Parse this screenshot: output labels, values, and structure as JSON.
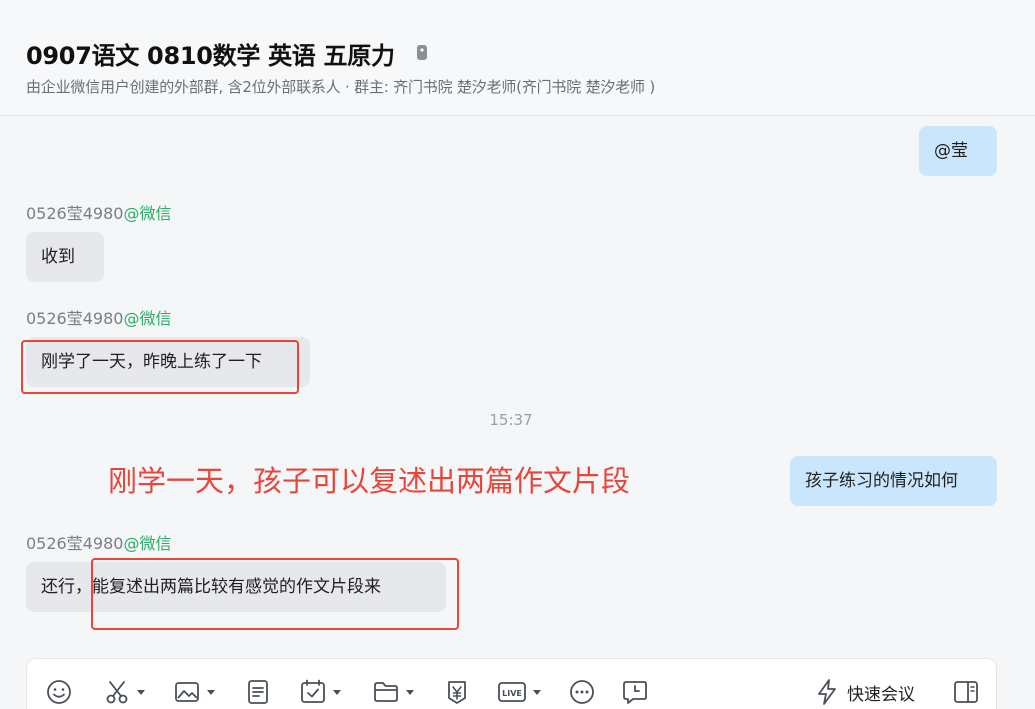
{
  "header": {
    "title": "0907语文  0810数学 英语 五原力",
    "subtitle": "由企业微信用户创建的外部群, 含2位外部联系人 · 群主: 齐门书院 楚汐老师(齐门书院 楚汐老师 )"
  },
  "messages": [
    {
      "side": "me",
      "text": "@莹"
    },
    {
      "side": "them",
      "sender": "0526莹4980",
      "source": "@微信",
      "text": "收到"
    },
    {
      "side": "them",
      "sender": "0526莹4980",
      "source": "@微信",
      "text": "刚学了一天，昨晚上练了一下"
    },
    {
      "timestamp": "15:37"
    },
    {
      "side": "me",
      "text": "孩子练习的情况如何"
    },
    {
      "side": "them",
      "sender": "0526莹4980",
      "source": "@微信",
      "text": "还行，能复述出两篇比较有感觉的作文片段来"
    }
  ],
  "annotation": {
    "text": "刚学一天，孩子可以复述出两篇作文片段",
    "color": "#e8463a"
  },
  "toolbar": {
    "icons": [
      "emoji-icon",
      "screenshot-icon",
      "image-icon",
      "document-icon",
      "schedule-icon",
      "folder-icon",
      "red-packet-icon",
      "live-icon",
      "more-icon",
      "time-message-icon",
      "quick-meeting-icon",
      "side-panel-icon"
    ],
    "meeting_label": "快速会议",
    "live_label": "LIVE"
  },
  "colors": {
    "my_bubble": "#c9e6fc",
    "their_bubble": "#e6e8eb",
    "source_green": "#2aae67",
    "annotation_red": "#e8463a"
  }
}
